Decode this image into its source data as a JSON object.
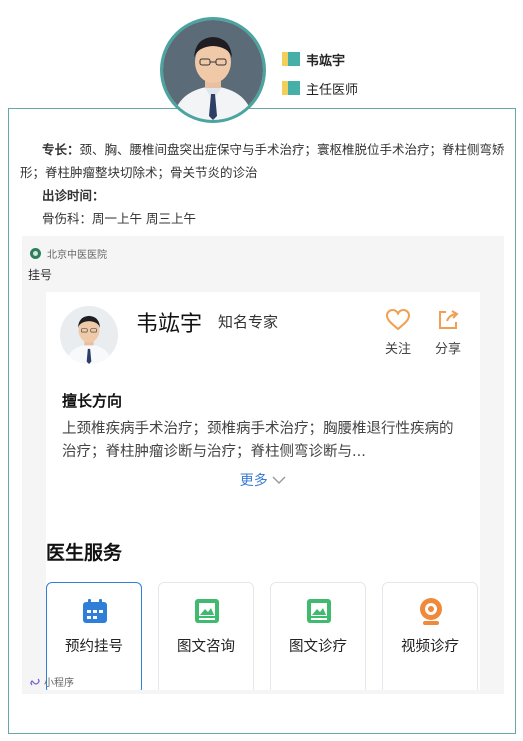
{
  "profile": {
    "name": "韦竑宇",
    "title": "主任医师",
    "specialty_label": "专长：",
    "specialty_text": "颈、胸、腰椎间盘突出症保守与手术治疗；寰枢椎脱位手术治疗；脊柱侧弯矫形；脊柱肿瘤整块切除术；骨关节炎的诊治",
    "clinic_label": "出诊时间：",
    "clinic_text": "骨伤科：周一上午 周三上午"
  },
  "mini_program": {
    "source_name": "北京中医医院",
    "page_title": "挂号",
    "footer_label": "小程序"
  },
  "doctor_card": {
    "name": "韦竑宇",
    "rank": "知名专家",
    "follow_label": "关注",
    "share_label": "分享",
    "section_title": "擅长方向",
    "section_text": "上颈椎疾病手术治疗；颈椎病手术治疗；胸腰椎退行性疾病的治疗；脊柱肿瘤诊断与治疗；脊柱侧弯诊断与...",
    "more_label": "更多"
  },
  "services": {
    "title": "医生服务",
    "items": [
      {
        "label": "预约挂号",
        "icon": "calendar-icon"
      },
      {
        "label": "图文咨询",
        "icon": "image-icon"
      },
      {
        "label": "图文诊疗",
        "icon": "image-icon"
      },
      {
        "label": "视频诊疗",
        "icon": "camera-icon"
      }
    ]
  },
  "colors": {
    "frame": "#6aa6a6",
    "teal": "#46b0a8",
    "yellow": "#f2cf5a",
    "accent_blue": "#3a7bd5",
    "orange": "#f0a050",
    "green": "#3fba6e"
  }
}
